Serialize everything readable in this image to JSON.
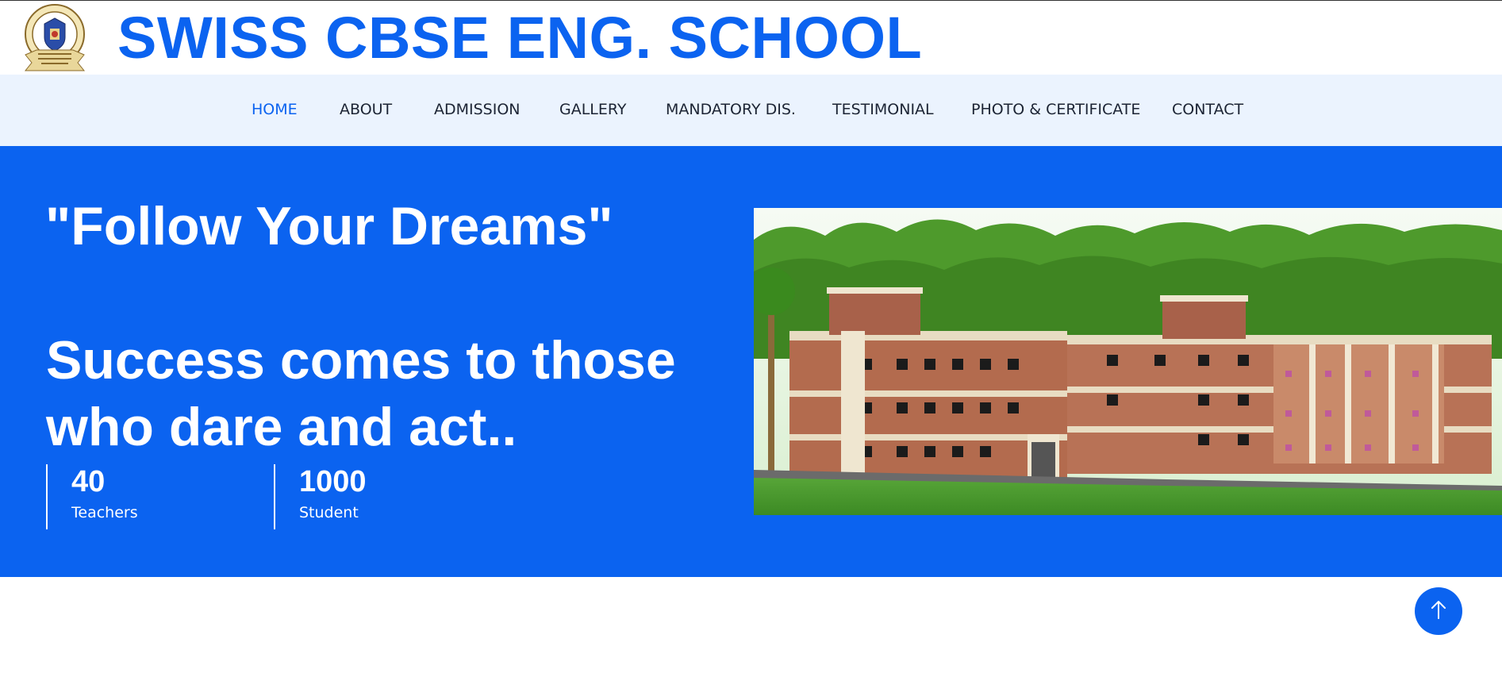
{
  "brand": {
    "name": "SWISS CBSE ENG. SCHOOL",
    "logo_icon": "school-crest-logo",
    "color": "#0b63f0"
  },
  "nav": {
    "items": [
      {
        "label": "HOME",
        "active": true
      },
      {
        "label": "ABOUT",
        "active": false
      },
      {
        "label": "ADMISSION",
        "active": false
      },
      {
        "label": "GALLERY",
        "active": false
      },
      {
        "label": "MANDATORY DIS.",
        "active": false
      },
      {
        "label": "TESTIMONIAL",
        "active": false
      },
      {
        "label": "PHOTO & CERTIFICATE",
        "active": false
      },
      {
        "label": "CONTACT",
        "active": false
      }
    ],
    "background": "#ebf3fe",
    "active_color": "#0b63f0"
  },
  "hero": {
    "quote": "\"Follow Your Dreams\"",
    "tagline": "Success comes to those who dare and act..",
    "background": "#0b63f0",
    "stats": [
      {
        "value": "40",
        "label": "Teachers"
      },
      {
        "value": "1000",
        "label": "Student"
      }
    ],
    "image_icon": "school-building-image"
  },
  "scroll_top": {
    "icon": "arrow-up-icon"
  }
}
